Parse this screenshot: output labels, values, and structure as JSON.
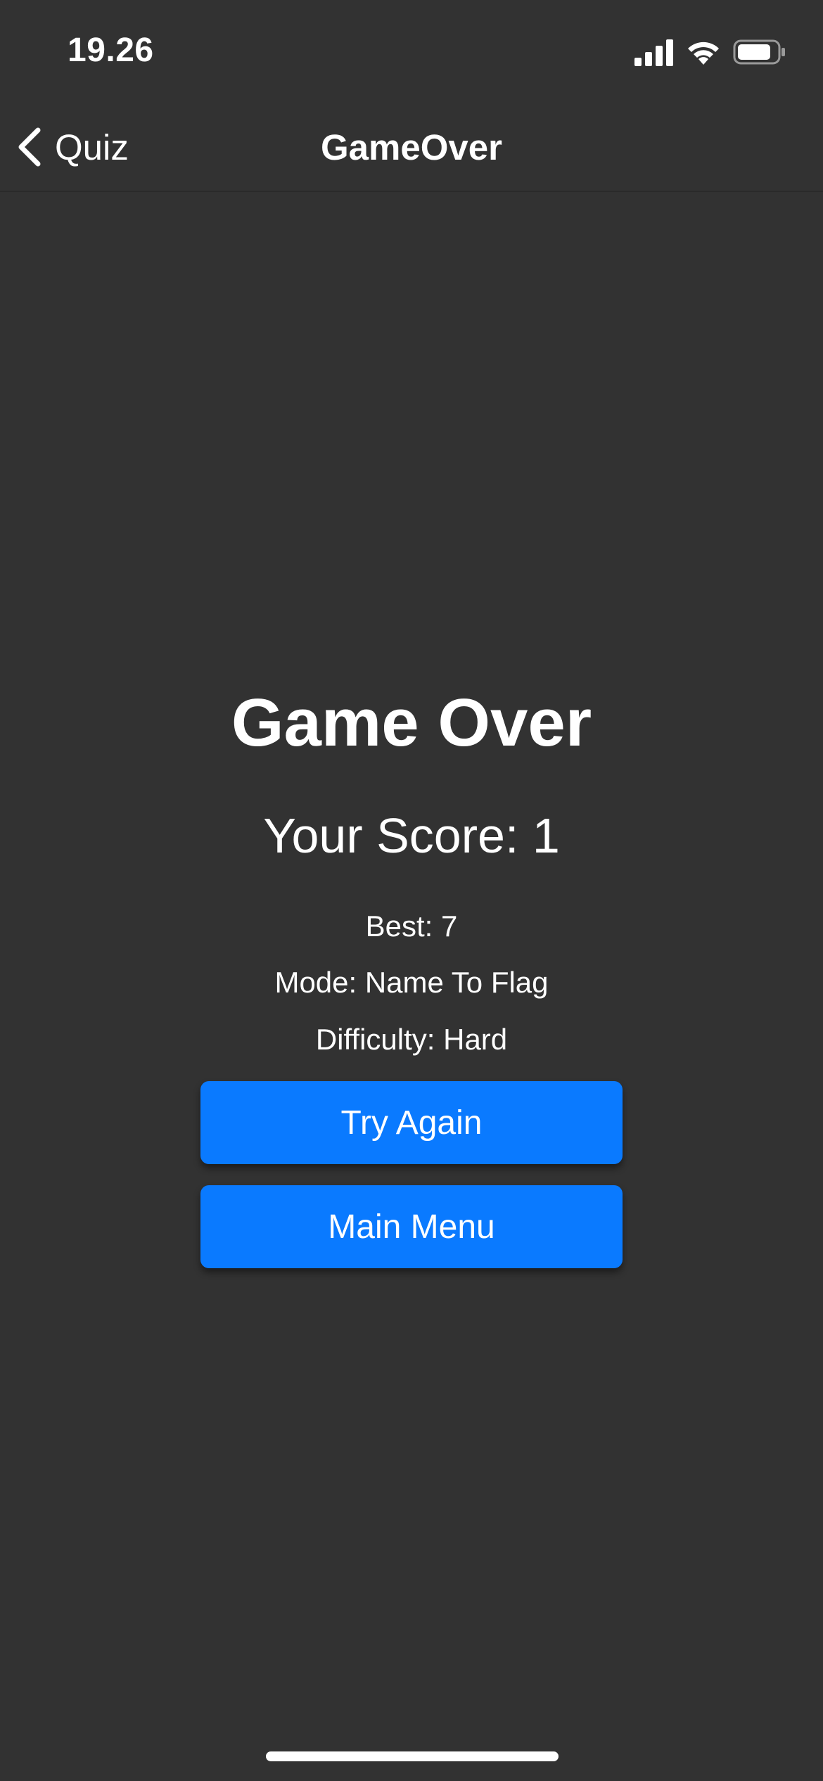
{
  "status_bar": {
    "time": "19.26",
    "icons": [
      "signal-icon",
      "wifi-icon",
      "battery-icon"
    ]
  },
  "nav": {
    "back_label": "Quiz",
    "back_icon": "chevron-left-icon",
    "title": "GameOver"
  },
  "content": {
    "title": "Game Over",
    "score": "Your Score: 1",
    "best": "Best: 7",
    "mode": "Mode: Name To Flag",
    "difficulty": "Difficulty: Hard"
  },
  "buttons": {
    "try_again": "Try Again",
    "main_menu": "Main Menu"
  },
  "colors": {
    "background": "#323232",
    "accent": "#0a7aff",
    "text": "#ffffff"
  }
}
